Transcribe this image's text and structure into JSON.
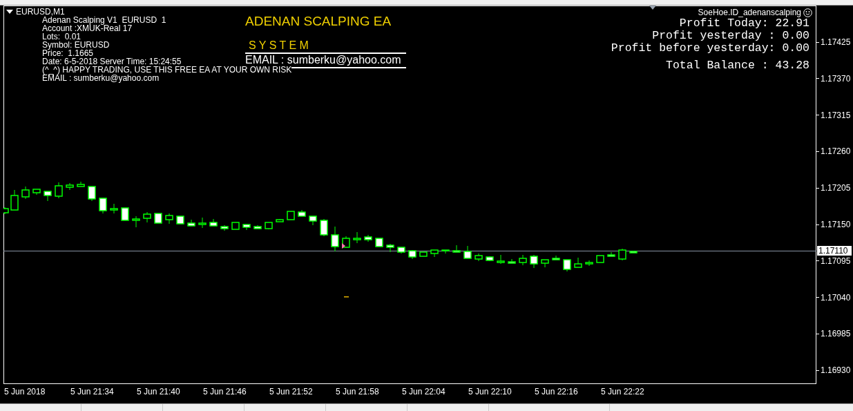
{
  "chart": {
    "symbol": "EURUSD,M1",
    "info_lines": [
      "Adenan Scalping V1  EURUSD  1",
      "Account :XMUK-Real 17",
      "Lots:  0.01",
      "Symbol: EURUSD",
      "Price:  1.1665",
      "Date: 6-5-2018 Server Time: 15:24:55",
      "(^_^) HAPPY TRADING, USE THIS FREE EA AT YOUR OWN RISK",
      "EMAIL : sumberku@yahoo.com"
    ],
    "title": "ADENAN SCALPING EA",
    "subtitle": "S Y S T E M",
    "email_banner": "EMAIL : sumberku@yahoo.com",
    "account_tag": "SoeHoe.ID_adenanscalping",
    "stats": [
      "Profit Today: 22.91",
      "Profit yesterday : 0.00",
      "Profit before yesterday: 0.00",
      "Total Balance : 43.28"
    ],
    "current_price": "1.17110"
  },
  "price_axis": {
    "labels": [
      "1.17425",
      "1.17370",
      "1.17315",
      "1.17260",
      "1.17205",
      "1.17150",
      "1.17095",
      "1.17040",
      "1.16985",
      "1.16930"
    ]
  },
  "time_axis": {
    "labels": [
      "5 Jun 2018",
      "5 Jun 21:34",
      "5 Jun 21:40",
      "5 Jun 21:46",
      "5 Jun 21:52",
      "5 Jun 21:58",
      "5 Jun 22:04",
      "5 Jun 22:10",
      "5 Jun 22:16",
      "5 Jun 22:22"
    ]
  }
}
